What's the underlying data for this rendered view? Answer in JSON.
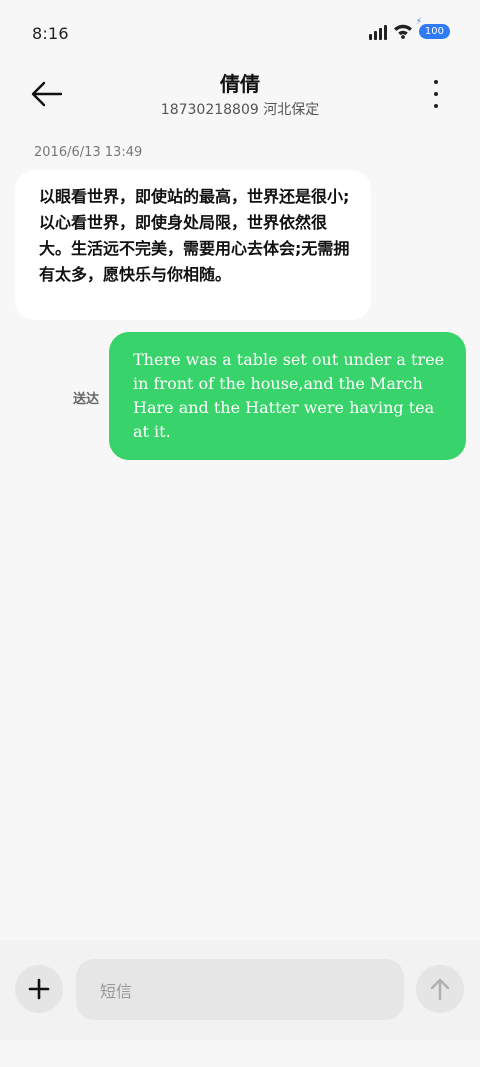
{
  "status_bar": {
    "time": "8:16",
    "battery": "100",
    "icons": [
      "signal-icon",
      "wifi-icon",
      "battery-icon"
    ]
  },
  "header": {
    "contact_name": "倩倩",
    "contact_detail": "18730218809 河北保定",
    "icons": [
      "back-arrow-icon",
      "more-vertical-icon"
    ]
  },
  "messages": {
    "timestamp": "2016/6/13 13:49",
    "incoming_text": "以眼看世界，即使站的最高，世界还是很小;以心看世界，即使身处局限，世界依然很大。生活远不完美，需要用心去体会;无需拥有太多，愿快乐与你相随。",
    "delivered_label": "送达",
    "outgoing_text": "There was a table set out under a tree in front of the house,and the March Hare and the Hatter were having tea at it."
  },
  "composer": {
    "placeholder": "短信",
    "icons": [
      "plus-icon",
      "send-arrow-icon"
    ]
  },
  "colors": {
    "background": "#f7f7f7",
    "incoming_bubble": "#ffffff",
    "outgoing_bubble": "#38d36a",
    "battery": "#2f7bf6"
  }
}
